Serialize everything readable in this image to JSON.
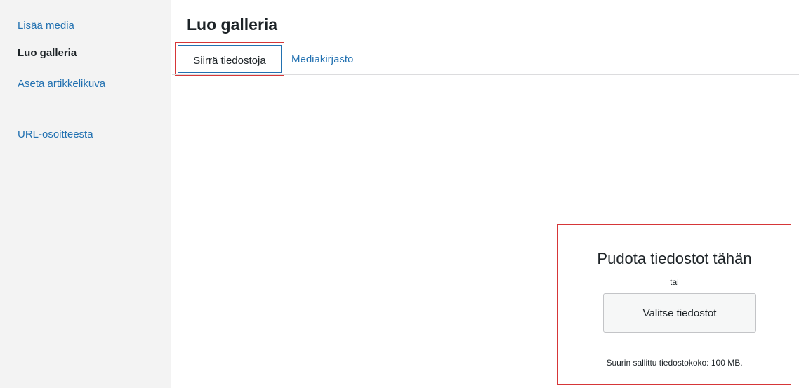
{
  "sidebar": {
    "items": [
      {
        "label": "Lisää media"
      },
      {
        "label": "Luo galleria"
      },
      {
        "label": "Aseta artikkelikuva"
      },
      {
        "label": "URL-osoitteesta"
      }
    ]
  },
  "main": {
    "title": "Luo galleria",
    "tabs": [
      {
        "label": "Siirrä tiedostoja",
        "selected": true
      },
      {
        "label": "Mediakirjasto",
        "selected": false
      }
    ]
  },
  "uploader": {
    "drop_title": "Pudota tiedostot tähän",
    "or_text": "tai",
    "select_button": "Valitse tiedostot",
    "max_size": "Suurin sallittu tiedostokoko: 100 MB."
  },
  "colors": {
    "link": "#2271b1",
    "text": "#1d2327",
    "sidebar_bg": "#f3f3f3",
    "highlight_border": "#d63638",
    "focus_border": "#2271b1"
  }
}
